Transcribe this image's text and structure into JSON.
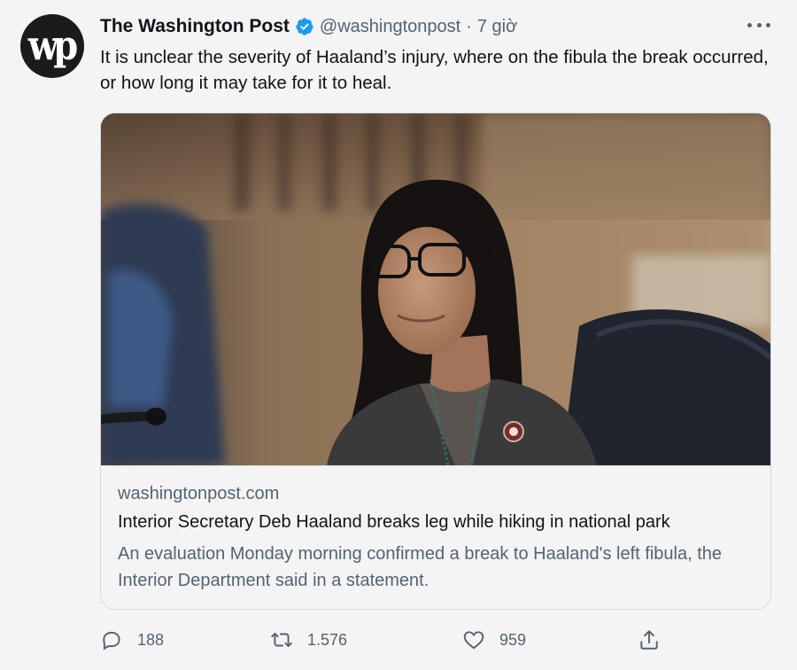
{
  "tweet": {
    "author_name": "The Washington Post",
    "handle": "@washingtonpost",
    "separator": "·",
    "time": "7 giờ",
    "avatar_label": "wp",
    "text": "It is unclear the severity of Haaland’s injury, where on the fibula the break occurred, or how long it may take for it to heal."
  },
  "card": {
    "domain": "washingtonpost.com",
    "title": "Interior Secretary Deb Haaland breaks leg while hiking in national park",
    "description": "An evaluation Monday morning confirmed a break to Haaland's left fibula, the Interior Department said in a statement."
  },
  "actions": {
    "replies": "188",
    "retweets": "1.576",
    "likes": "959"
  },
  "colors": {
    "verified_blue": "#1d9bf0",
    "secondary_text": "#536471",
    "primary_text": "#0f1419",
    "background": "#f4f4f4"
  },
  "icons": [
    "verified-badge-icon",
    "more-options-icon",
    "reply-icon",
    "retweet-icon",
    "like-icon",
    "share-icon"
  ]
}
